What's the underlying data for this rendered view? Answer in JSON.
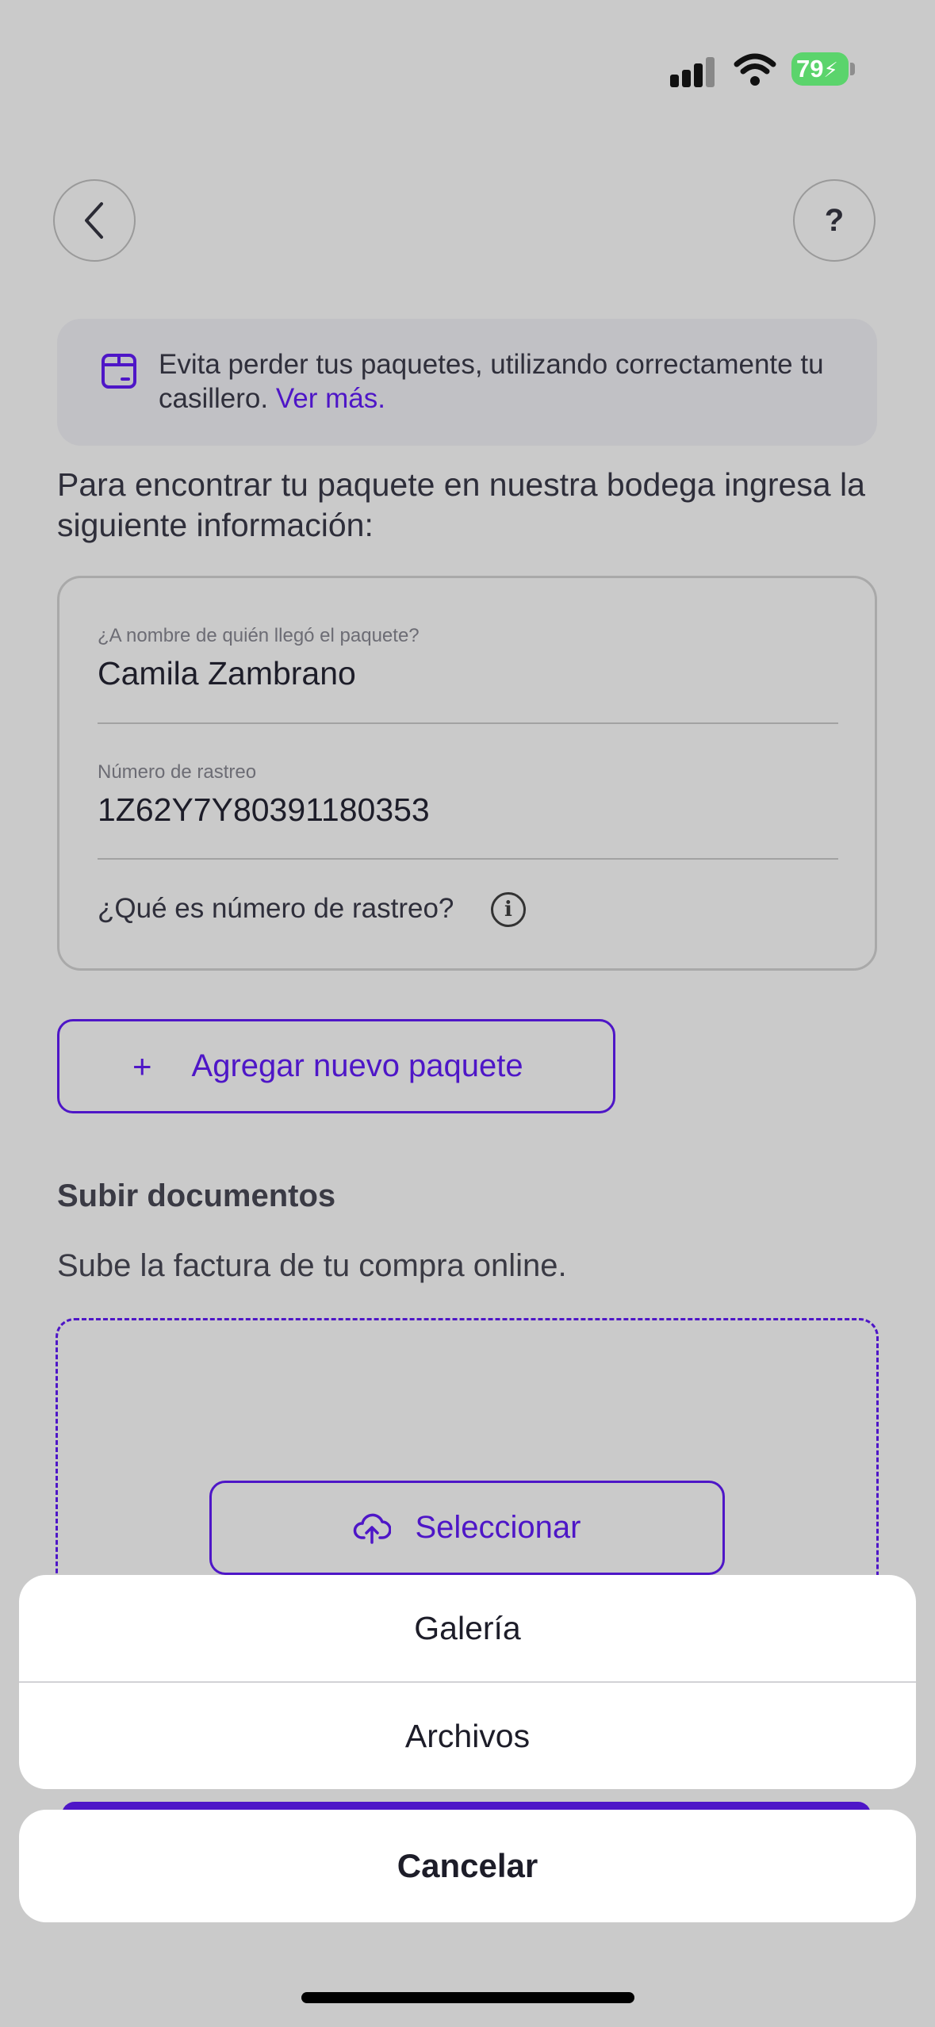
{
  "status_bar": {
    "battery": "79",
    "icons": [
      "signal-icon",
      "wifi-icon",
      "battery-charging-icon"
    ]
  },
  "header": {
    "back_icon": "chevron-left-icon",
    "help_label": "?"
  },
  "banner": {
    "icon": "package-box-icon",
    "text": "Evita perder tus paquetes, utilizando correctamente tu casillero.",
    "link": "Ver más."
  },
  "intro": "Para encontrar tu paquete en nuestra bodega ingresa la siguiente información:",
  "form": {
    "name_label": "¿A nombre de quién llegó el paquete?",
    "name_value": "Camila Zambrano",
    "tracking_label": "Número de rastreo",
    "tracking_value": "1Z62Y7Y80391180353",
    "tracking_help": "¿Qué es número de rastreo?",
    "info_icon": "info-icon"
  },
  "add_package": {
    "icon": "+",
    "label": "Agregar nuevo paquete"
  },
  "documents": {
    "title": "Subir documentos",
    "subtitle": "Sube la factura de tu compra online.",
    "select_icon": "cloud-upload-icon",
    "select_label": "Seleccionar"
  },
  "action_sheet": {
    "options": [
      "Galería",
      "Archivos"
    ],
    "cancel": "Cancelar"
  },
  "colors": {
    "accent": "#4E16C7",
    "background": "#CACACA",
    "sheet": "#FFFFFF",
    "battery": "#5BD46C"
  }
}
